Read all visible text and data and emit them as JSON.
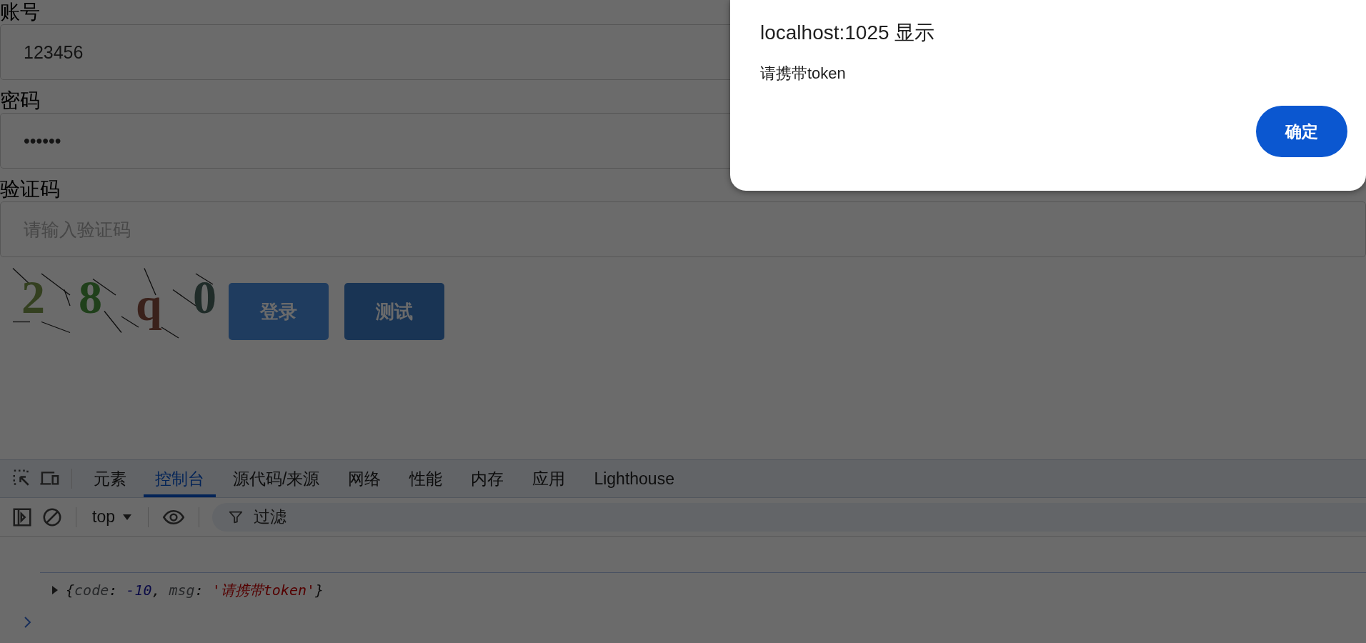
{
  "form": {
    "fields": [
      {
        "label": "账号",
        "value": "123456"
      },
      {
        "label": "密码",
        "value": "••••••"
      },
      {
        "label": "验证码",
        "placeholder": "请输入验证码"
      }
    ],
    "captcha": {
      "chars": [
        "2",
        "8",
        "q",
        "0"
      ]
    },
    "buttons": [
      {
        "label": "登录",
        "kind": "primary"
      },
      {
        "label": "测试",
        "kind": "secondary"
      }
    ]
  },
  "dialog": {
    "title": "localhost:1025 显示",
    "message": "请携带token",
    "button": "确定"
  },
  "devtools": {
    "tabs": [
      {
        "label": "元素",
        "selected": false
      },
      {
        "label": "控制台",
        "selected": true
      },
      {
        "label": "源代码/来源",
        "selected": false
      },
      {
        "label": "网络",
        "selected": false
      },
      {
        "label": "性能",
        "selected": false
      },
      {
        "label": "内存",
        "selected": false
      },
      {
        "label": "应用",
        "selected": false
      },
      {
        "label": "Lighthouse",
        "selected": false
      }
    ],
    "context": "top",
    "filter": {
      "placeholder": "过滤"
    },
    "log": [
      {
        "kind": "punct",
        "text": "{"
      },
      {
        "kind": "key",
        "text": "code"
      },
      {
        "kind": "punct",
        "text": ": "
      },
      {
        "kind": "number",
        "text": "-10"
      },
      {
        "kind": "punct",
        "text": ", "
      },
      {
        "kind": "key",
        "text": "msg"
      },
      {
        "kind": "punct",
        "text": ": "
      },
      {
        "kind": "string",
        "text": "'请携带token'"
      },
      {
        "kind": "punct",
        "text": "}"
      }
    ]
  }
}
